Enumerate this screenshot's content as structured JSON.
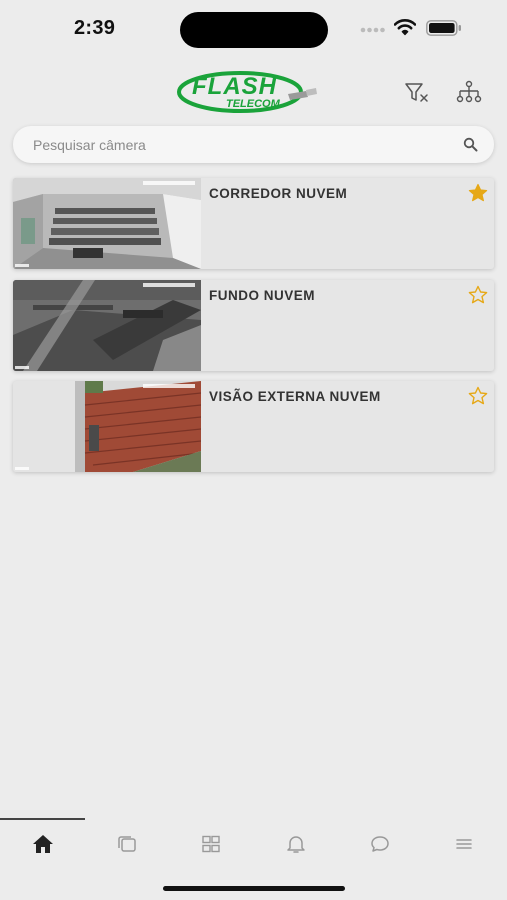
{
  "status_bar": {
    "time": "2:39"
  },
  "header": {
    "logo_primary": "FLASH",
    "logo_secondary": "TELECOM",
    "brand_color": "#1aa33a",
    "actions": [
      "clear-filter-icon",
      "hierarchy-icon"
    ]
  },
  "search": {
    "placeholder": "Pesquisar câmera",
    "value": ""
  },
  "cameras": [
    {
      "name": "CORREDOR NUVEM",
      "favorite": true
    },
    {
      "name": "FUNDO NUVEM",
      "favorite": false
    },
    {
      "name": "VISÃO EXTERNA NUVEM",
      "favorite": false
    }
  ],
  "tabs": [
    {
      "icon": "home-icon",
      "active": true
    },
    {
      "icon": "multi-window-icon",
      "active": false
    },
    {
      "icon": "grid-icon",
      "active": false
    },
    {
      "icon": "bell-icon",
      "active": false
    },
    {
      "icon": "chat-icon",
      "active": false
    },
    {
      "icon": "menu-icon",
      "active": false
    }
  ],
  "colors": {
    "favorite_star": "#e6a817",
    "background": "#ececec",
    "card": "#e6e6e6"
  }
}
